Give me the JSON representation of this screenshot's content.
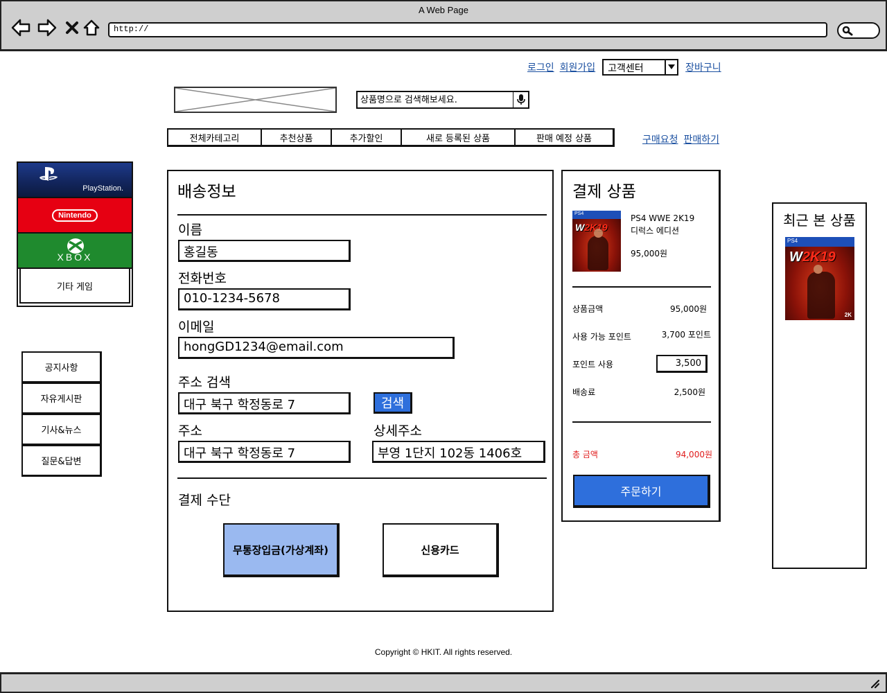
{
  "browser": {
    "window_title": "A Web Page",
    "url": "http://"
  },
  "top_links": {
    "login": "로그인",
    "signup": "회원가입",
    "support_select": "고객센터",
    "cart": "장바구니"
  },
  "search": {
    "placeholder": "상품명으로 검색해보세요."
  },
  "nav_tabs": [
    "전체카테고리",
    "추천상품",
    "추가할인",
    "새로 등록된 상품",
    "판매 예정 상품"
  ],
  "sub_links": {
    "buy_request": "구매요청",
    "sell": "판매하기"
  },
  "brands": {
    "playstation": "PlayStation.",
    "nintendo": "Nintendo",
    "xbox": "XBOX",
    "other": "기타 게임"
  },
  "board": [
    "공지사항",
    "자유게시판",
    "기사&뉴스",
    "질문&답변"
  ],
  "shipping": {
    "title": "배송정보",
    "name_label": "이름",
    "name_value": "홍길동",
    "phone_label": "전화번호",
    "phone_value": "010-1234-5678",
    "email_label": "이메일",
    "email_value": "hongGD1234@email.com",
    "address_search_label": "주소 검색",
    "address_search_value": "대구 북구 학정동로 7",
    "search_button": "검색",
    "address_label": "주소",
    "address_value": "대구 북구 학정동로 7",
    "detail_label": "상세주소",
    "detail_value": "부영 1단지 102동 1406호"
  },
  "payment": {
    "title": "결제 수단",
    "bank_transfer": "무통장입금(가상계좌)",
    "credit_card": "신용카드"
  },
  "summary": {
    "title": "결제 상품",
    "product_name_line1": "PS4 WWE 2K19",
    "product_name_line2": "디럭스 에디션",
    "product_price": "95,000원",
    "rows": {
      "item_price_label": "상품금액",
      "item_price_value": "95,000원",
      "available_points_label": "사용 가능 포인트",
      "available_points_value": "3,700 포인트",
      "use_points_label": "포인트 사용",
      "use_points_value": "3,500",
      "shipping_fee_label": "배송료",
      "shipping_fee_value": "2,500원"
    },
    "total_label": "총 금액",
    "total_value": "94,000원",
    "order_button": "주문하기"
  },
  "box_art": {
    "platform": "PS4",
    "title_w": "W",
    "title_2k19": "2K19",
    "publisher": "2K"
  },
  "recent": {
    "title": "최근 본 상품"
  },
  "footer": {
    "copyright": "Copyright © HKIT. All rights reserved."
  },
  "colors": {
    "accent_blue": "#2e6fdc",
    "selected_pay": "#9ab9f0",
    "link": "#1a4fa0",
    "total_red": "#e01b1b"
  }
}
